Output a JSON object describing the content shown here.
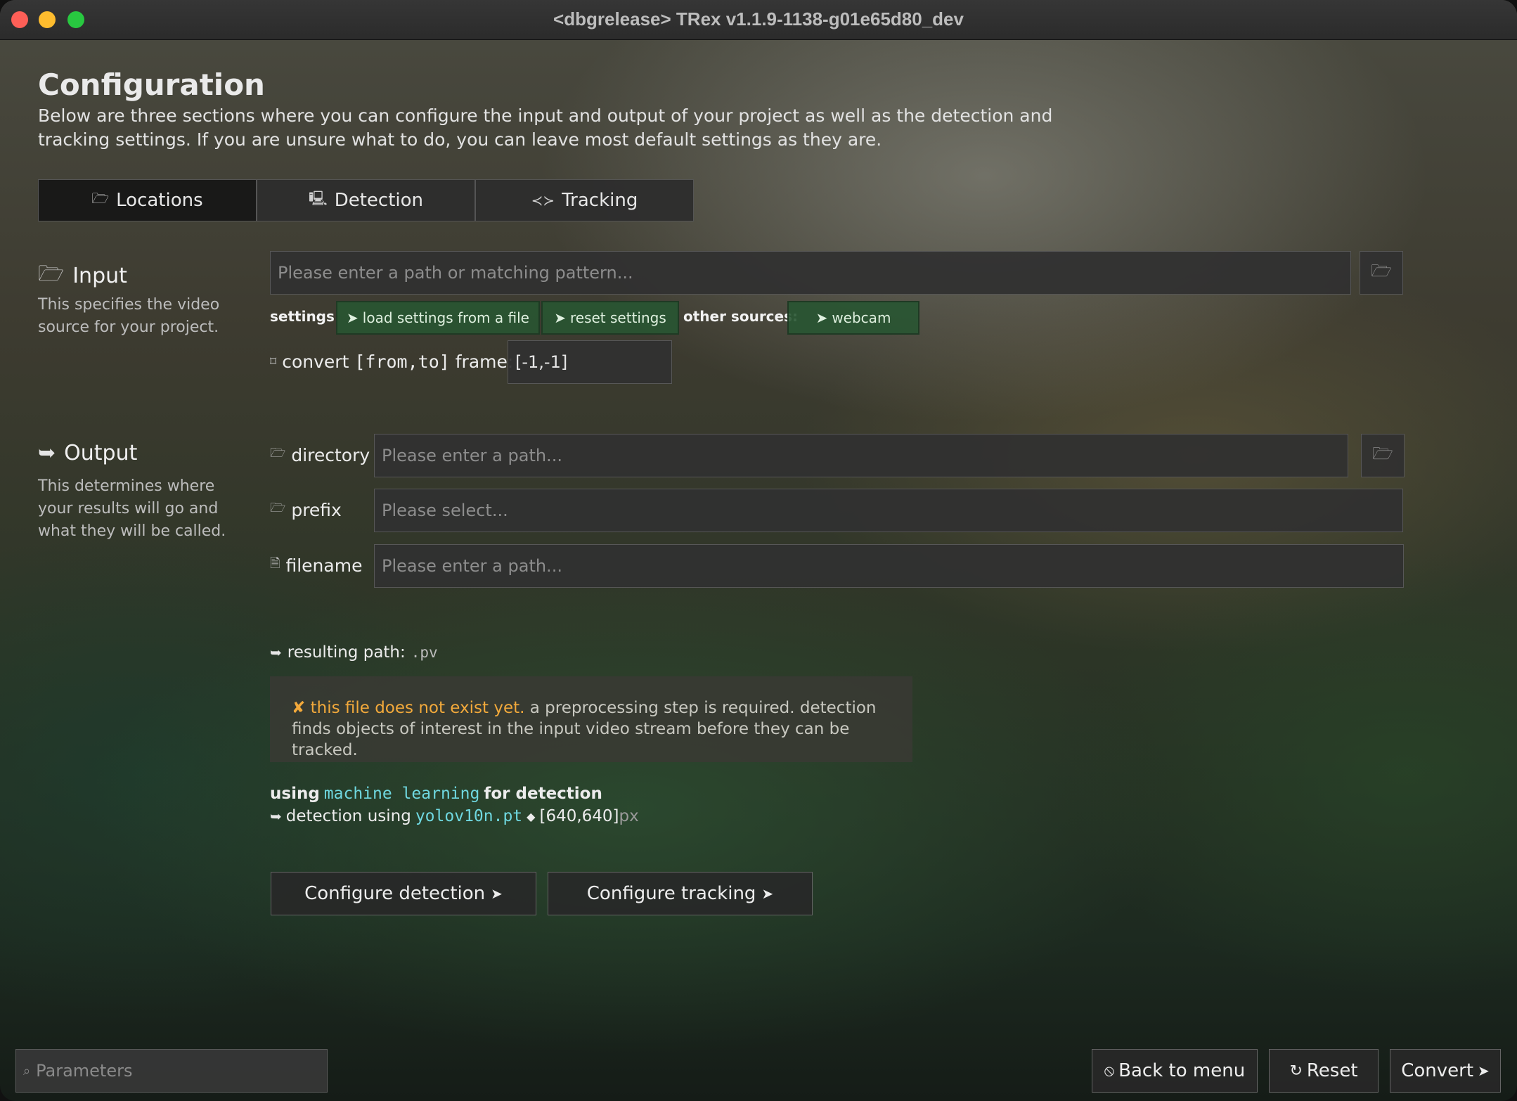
{
  "window": {
    "title": "<dbgrelease> TRex v1.1.9-1138-g01e65d80_dev"
  },
  "page": {
    "title": "Configuration",
    "description": "Below are three sections where you can configure the input and output of your project as well as the detection and tracking settings. If you are unsure what to do, you can leave most default settings as they are."
  },
  "tabs": [
    {
      "label": "Locations",
      "icon": "folder-icon",
      "active": true
    },
    {
      "label": "Detection",
      "icon": "monitor-icon",
      "active": false
    },
    {
      "label": "Tracking",
      "icon": "fish-icon",
      "active": false
    }
  ],
  "input": {
    "heading": "Input",
    "description": "This specifies the video source for your project.",
    "path_placeholder": "Please enter a path or matching pattern...",
    "settings_label": "settings",
    "load_settings_label": "load settings from a file",
    "reset_settings_label": "reset settings",
    "other_sources_label": "other sources:",
    "webcam_label": "webcam",
    "convert_label_pre": "convert ",
    "convert_label_code": "[from,to]",
    "convert_label_post": " frame:",
    "convert_value": "[-1,-1]"
  },
  "output": {
    "heading": "Output",
    "description": "This determines where your results will go and what they will be called.",
    "directory_label": "directory",
    "directory_placeholder": "Please enter a path...",
    "prefix_label": "prefix",
    "prefix_placeholder": "Please select...",
    "filename_label": "filename",
    "filename_placeholder": "Please enter a path...",
    "resulting_path_label": "resulting path:",
    "resulting_path_value": ".pv",
    "info_warn": "this file does not exist yet.",
    "info_text": " a preprocessing step is required. detection finds objects of interest in the input video stream before they can be tracked."
  },
  "detection_summary": {
    "using_label": "using",
    "method": "machine learning",
    "for_label": "for detection",
    "detection_using_label": "detection using",
    "model": "yolov10n.pt",
    "resolution": "[640,640]",
    "unit": "px"
  },
  "buttons": {
    "configure_detection": "Configure detection",
    "configure_tracking": "Configure tracking",
    "back_to_menu": "Back to menu",
    "reset": "Reset",
    "convert": "Convert"
  },
  "search": {
    "placeholder": "Parameters"
  },
  "colors": {
    "warning": "#f2a93b",
    "code": "#6fd8e0",
    "green_button": "#28553a"
  }
}
